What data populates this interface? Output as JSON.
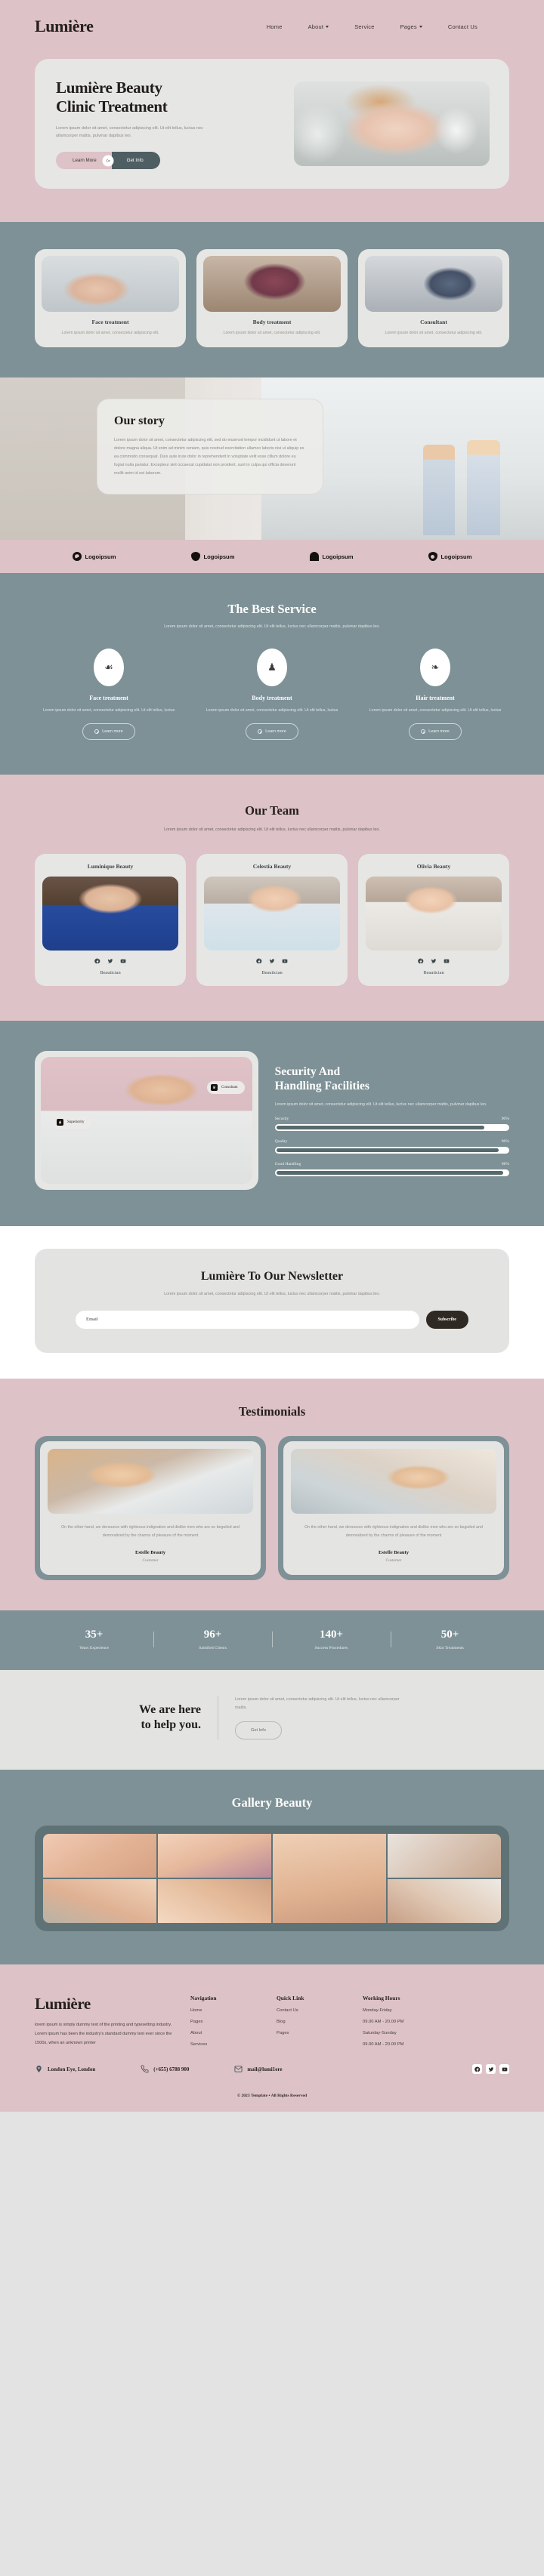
{
  "brand": "Lumière",
  "nav": {
    "items": [
      {
        "label": "Home",
        "dropdown": false
      },
      {
        "label": "About",
        "dropdown": true
      },
      {
        "label": "Service",
        "dropdown": false
      },
      {
        "label": "Pages",
        "dropdown": true
      },
      {
        "label": "Contact Us",
        "dropdown": false
      }
    ]
  },
  "hero": {
    "title_line1": "Lumière Beauty",
    "title_line2": "Clinic Treatment",
    "description": "Lorem ipsum dolor sit amet, consectetur adipiscing elit. Ut elit tellus, luctus nec ullamcorper mattis, pulvinar dapibus leo.",
    "btn_primary": "Learn More",
    "btn_or": "Or",
    "btn_secondary": "Get Info"
  },
  "service_cards": [
    {
      "title": "Face treatment",
      "desc": "Lorem ipsum dolor sit amet, consectetur adipiscing elit."
    },
    {
      "title": "Body treatment",
      "desc": "Lorem ipsum dolor sit amet, consectetur adipiscing elit."
    },
    {
      "title": "Consultant",
      "desc": "Lorem ipsum dolor sit amet, consectetur adipiscing elit."
    }
  ],
  "story": {
    "title": "Our story",
    "text": "Lorem ipsum dolor sit amet, consectetur adipiscing elit, sed do eiusmod tempor incididunt ut labore et dolore magna aliqua. Ut enim ad minim veniam, quis nostrud exercitation ullamco laboris nisi ut aliquip ex ea commodo consequat. Duis aute irure dolor in reprehenderit in voluptate velit esse cillum dolore eu fugiat nulla pariatur. Excepteur sint occaecat cupidatat non proident, sunt in culpa qui officia deserunt mollit anim id est laborum."
  },
  "logos": [
    {
      "label": "Logoipsum",
      "mark": "circle-check-logo-icon"
    },
    {
      "label": "Logoipsum",
      "mark": "shield-outline-logo-icon"
    },
    {
      "label": "Logoipsum",
      "mark": "arch-logo-icon"
    },
    {
      "label": "Logoipsum",
      "mark": "ring-logo-icon"
    }
  ],
  "best_service": {
    "title": "The Best Service",
    "subtitle": "Lorem ipsum dolor sit amet, consectetur adipiscing elit. Ut elit tellus, luctus nec ullamcorper mattis, pulvinar dapibus leo.",
    "items": [
      {
        "icon": "face-treatment-icon",
        "glyph": "☙",
        "title": "Face treatment",
        "desc": "Lorem ipsum dolor sit amet, consectetur adipiscing elit. Ut elit tellus, luctus",
        "cta": "Learn more"
      },
      {
        "icon": "body-treatment-icon",
        "glyph": "♟",
        "title": "Body treatment",
        "desc": "Lorem ipsum dolor sit amet, consectetur adipiscing elit. Ut elit tellus, luctus",
        "cta": "Learn more"
      },
      {
        "icon": "hair-treatment-icon",
        "glyph": "❧",
        "title": "Hair treatment",
        "desc": "Lorem ipsum dolor sit amet, consectetur adipiscing elit. Ut elit tellus, luctus",
        "cta": "Learn more"
      }
    ]
  },
  "team": {
    "title": "Our Team",
    "subtitle": "Lorem ipsum dolor sit amet, consectetur adipiscing elit. Ut elit tellus, luctus nec ullamcorper mattis, pulvinar dapibus leo.",
    "members": [
      {
        "name": "Luminique Beauty",
        "role": "Beautician"
      },
      {
        "name": "Celestia Beauty",
        "role": "Beautician"
      },
      {
        "name": "Olivia Beauty",
        "role": "Beautician"
      }
    ],
    "socials": [
      "facebook-icon",
      "twitter-icon",
      "youtube-icon"
    ]
  },
  "security": {
    "badges": [
      {
        "label": "Consultant",
        "icon": "consultant-badge-icon"
      },
      {
        "label": "Superiority",
        "icon": "superiority-badge-icon"
      }
    ],
    "title_line1": "Security And",
    "title_line2": "Handling Facilities",
    "description": "Lorem ipsum dolor sit amet, consectetur adipiscing elit. Ut elit tellus, luctus nec ullamcorper mattis, pulvinar dapibus leo.",
    "bars": [
      {
        "label": "Security",
        "value": "90%",
        "pct": 90
      },
      {
        "label": "Quality",
        "value": "96%",
        "pct": 96
      },
      {
        "label": "Good Handling",
        "value": "98%",
        "pct": 98
      }
    ]
  },
  "newsletter": {
    "title": "Lumière To Our Newsletter",
    "subtitle": "Lorem ipsum dolor sit amet, consectetur adipiscing elit. Ut elit tellus, luctus nec ullamcorper mattis, pulvinar dapibus leo.",
    "placeholder": "Email",
    "button": "Subscribe"
  },
  "testimonials": {
    "title": "Testimonials",
    "items": [
      {
        "quote": "On the other hand, we denounce with righteous indignation and dislike men who are so beguiled and demoralized by the charms of pleasure of the moment",
        "name": "Estelle Beauty",
        "role": "Customer"
      },
      {
        "quote": "On the other hand, we denounce with righteous indignation and dislike men who are so beguiled and demoralized by the charms of pleasure of the moment",
        "name": "Estelle Beauty",
        "role": "Customer"
      }
    ]
  },
  "stats": [
    {
      "value": "35+",
      "label": "Years Experience"
    },
    {
      "value": "96+",
      "label": "Satisfied Clients"
    },
    {
      "value": "140+",
      "label": "Success Procedures"
    },
    {
      "value": "50+",
      "label": "Skin Treatments"
    }
  ],
  "help": {
    "title_line1": "We are here",
    "title_line2": "to help you.",
    "text": "Lorem ipsum dolor sit amet, consectetur adipiscing elit. Ut elit tellus, luctus nec ullamcorper mattis.",
    "button": "Get Info"
  },
  "gallery": {
    "title": "Gallery Beauty"
  },
  "footer": {
    "brand": "Lumière",
    "about": "lorem ipsum is simply dummy text of the printing and typesetting industry. Lorem ipsum has been the industry's standard dummy text ever since the 1500s, when an unknown printer",
    "nav_heading": "Navigation",
    "nav_items": [
      "Home",
      "Pages",
      "About",
      "Services"
    ],
    "quick_heading": "Quick Link",
    "quick_items": [
      "Contact Us",
      "Blog",
      "Pages"
    ],
    "hours_heading": "Working Hours",
    "hours": [
      "Monday-Friday",
      "09.00 AM - 20.00 PM",
      "Saturday-Sunday",
      "09.00 AM - 20.00 PM"
    ],
    "contacts": [
      {
        "icon": "location-pin-icon",
        "label": "London Eye, London"
      },
      {
        "icon": "phone-icon",
        "label": "(+655) 6788 900"
      },
      {
        "icon": "mail-icon",
        "label": "mail@lumi1ere"
      }
    ],
    "socials": [
      "facebook-icon",
      "twitter-icon",
      "youtube-icon"
    ],
    "copyright": "© 2023 Template • All Rights Reserved"
  }
}
